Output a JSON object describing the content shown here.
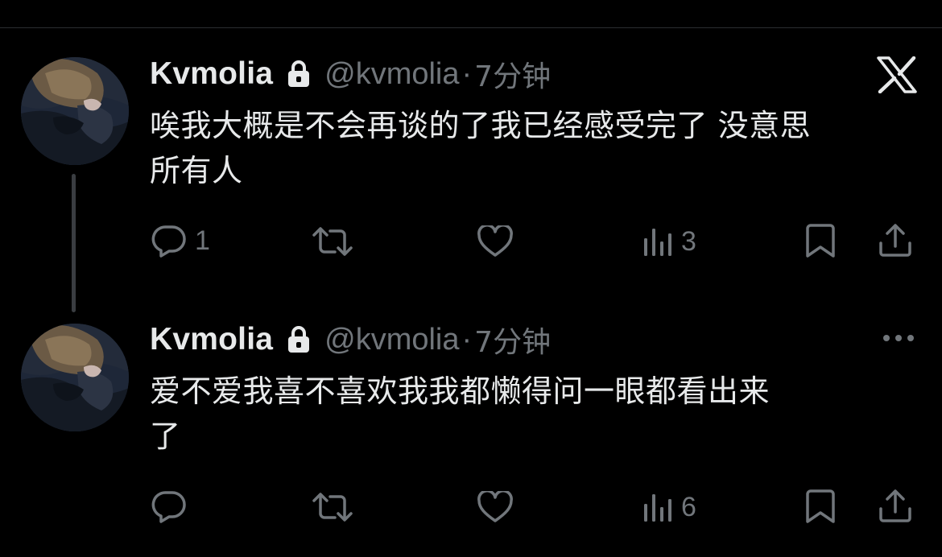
{
  "colors": {
    "background": "#000000",
    "primary_text": "#e7e9ea",
    "secondary_text": "#71767b",
    "thread_line": "#3a3d41"
  },
  "tweets": [
    {
      "display_name": "Kvmolia",
      "handle": "@kvmolia",
      "separator": "·",
      "time": "7分钟",
      "text_lines": [
        "唉我大概是不会再谈的了我已经感受完了 没意思",
        "所有人"
      ],
      "reply_count": "1",
      "retweet_count": "",
      "like_count": "",
      "view_count": "3",
      "corner_icon": "x-logo-icon"
    },
    {
      "display_name": "Kvmolia",
      "handle": "@kvmolia",
      "separator": "·",
      "time": "7分钟",
      "text_lines": [
        "爱不爱我喜不喜欢我我都懒得问一眼都看出来",
        "了"
      ],
      "reply_count": "",
      "retweet_count": "",
      "like_count": "",
      "view_count": "6",
      "corner_icon": "more-icon"
    }
  ]
}
